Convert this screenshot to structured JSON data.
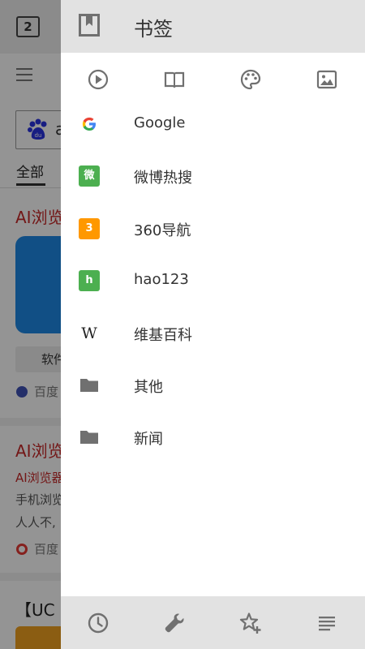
{
  "background_page": {
    "tab_count": "2",
    "search_text": "a",
    "tab_all": "全部",
    "result1_title": "AI浏览",
    "result1_button": "软件",
    "result1_source": "百度",
    "result2_title": "AI浏览",
    "result2_subtitle": "AI浏览器",
    "result2_line1": "手机浏览",
    "result2_line2": "人人不,",
    "result2_source": "百度",
    "result3_title": "【UC"
  },
  "drawer": {
    "title": "书签",
    "header_icon": "bookmark-icon",
    "filters": [
      {
        "icon": "video-icon"
      },
      {
        "icon": "book-icon"
      },
      {
        "icon": "palette-icon"
      },
      {
        "icon": "image-icon"
      }
    ],
    "bookmarks": [
      {
        "label": "Google",
        "icon": "google-icon"
      },
      {
        "label": "微博热搜",
        "icon": "weibo-icon",
        "badge": "微",
        "color": "#4caf50"
      },
      {
        "label": "360导航",
        "icon": "360-icon",
        "badge": "3",
        "color": "#ff9800"
      },
      {
        "label": "hao123",
        "icon": "hao123-icon",
        "badge": "h",
        "color": "#4caf50"
      },
      {
        "label": "维基百科",
        "icon": "wikipedia-icon",
        "badge": "W"
      },
      {
        "label": "其他",
        "icon": "folder-icon"
      },
      {
        "label": "新闻",
        "icon": "folder-icon"
      }
    ],
    "footer": [
      {
        "icon": "history-icon"
      },
      {
        "icon": "wrench-icon"
      },
      {
        "icon": "star-add-icon"
      },
      {
        "icon": "list-icon"
      }
    ]
  },
  "colors": {
    "header_bg": "#e2e2e2",
    "icon_gray": "#707070",
    "link_red": "#c62828"
  }
}
